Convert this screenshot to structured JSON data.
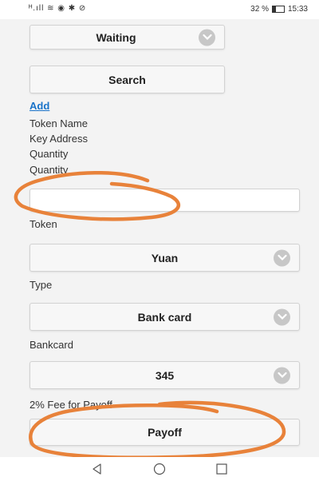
{
  "status_bar": {
    "signal_text": "ᴴ.ıll ≋ ◉ ✱ ⊘",
    "battery_text": "32 %",
    "time": "15:33"
  },
  "form": {
    "status_select": "Waiting",
    "search_button": "Search",
    "add_link": "Add",
    "info_lines": [
      "Token Name",
      "Key Address",
      "Quantity"
    ],
    "quantity_label": "Quantity",
    "quantity_value": "",
    "token_label": "Token",
    "token_select": "Yuan",
    "type_label": "Type",
    "type_select": "Bank card",
    "bankcard_label": "Bankcard",
    "bankcard_select": "345",
    "fee_label": "2% Fee for Payoff",
    "payoff_button": "Payoff"
  },
  "colors": {
    "annotation": "#e8823a",
    "link": "#1a73c9"
  },
  "icons": [
    "chevron-down-icon",
    "back-icon",
    "home-icon",
    "recents-icon"
  ]
}
